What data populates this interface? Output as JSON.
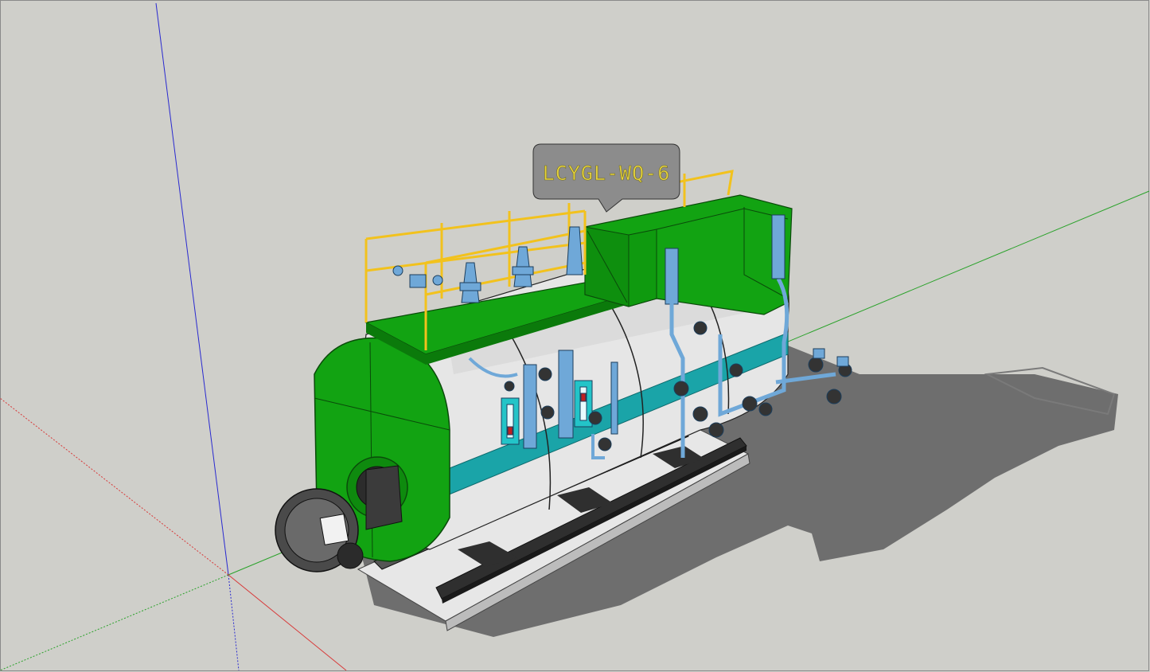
{
  "model_label": {
    "text": "LCYGL-WQ-6"
  },
  "colors": {
    "background": "#cfcfca",
    "shell": "#e6e6e6",
    "green": "#12a312",
    "teal": "#1aa4a8",
    "railing": "#f2c21d",
    "pipe": "#5f9ad1",
    "base": "#2f2f2f",
    "shadow": "#6e6e6e",
    "axis_red": "#d83a3a",
    "axis_green": "#2aa22a",
    "axis_blue": "#2a2ad0"
  }
}
